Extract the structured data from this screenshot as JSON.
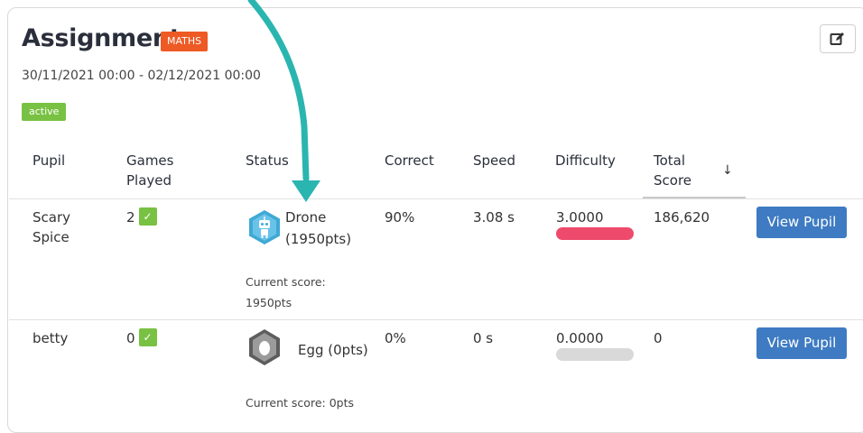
{
  "header": {
    "title": "Assignment",
    "subject_badge": "MATHS",
    "date_range": "30/11/2021 00:00 - 02/12/2021 00:00",
    "status_badge": "active"
  },
  "table": {
    "columns": {
      "pupil": "Pupil",
      "games_played_1": "Games",
      "games_played_2": "Played",
      "status": "Status",
      "correct": "Correct",
      "speed": "Speed",
      "difficulty": "Difficulty",
      "total_score_1": "Total",
      "total_score_2": "Score",
      "sort_indicator": "↓"
    },
    "rows": [
      {
        "pupil_1": "Scary",
        "pupil_2": "Spice",
        "games_played": "2",
        "check": "✓",
        "status_name": "Drone",
        "status_pts": "(1950pts)",
        "current_score_label": "Current score:",
        "current_score_value": "1950pts",
        "correct": "90%",
        "speed": "3.08 s",
        "difficulty": "3.0000",
        "total_score": "186,620",
        "view_button": "View Pupil"
      },
      {
        "pupil_1": "betty",
        "games_played": "0",
        "check": "✓",
        "status_name": "Egg (0pts)",
        "current_score_label": "Current score: 0pts",
        "correct": "0%",
        "speed": "0 s",
        "difficulty": "0.0000",
        "total_score": "0",
        "view_button": "View Pupil"
      }
    ]
  },
  "colors": {
    "subject_badge": "#ee5a24",
    "active_badge": "#79c143",
    "view_button": "#3e7bc2",
    "difficulty_high": "#ee4a6b",
    "difficulty_none": "#d9d9d9",
    "annotation_arrow": "#2bb5b0"
  },
  "icons": {
    "edit": "edit-icon",
    "drone_avatar": "robot-hexagon-icon",
    "egg_avatar": "egg-hexagon-icon",
    "annotation": "teal-arrow"
  }
}
